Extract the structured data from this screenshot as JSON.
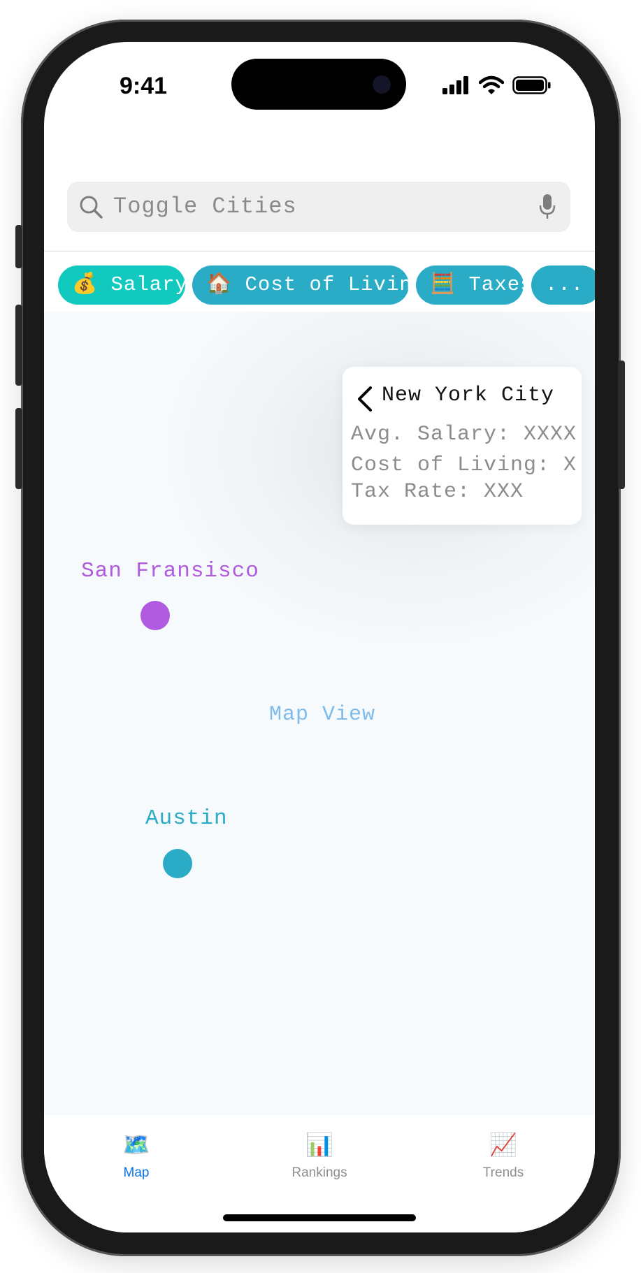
{
  "status_bar": {
    "time": "9:41"
  },
  "search": {
    "placeholder": "Toggle Cities"
  },
  "filters": [
    {
      "emoji": "💰",
      "label": "Salary",
      "active": true
    },
    {
      "emoji": "🏠",
      "label": "Cost of Living",
      "active": false
    },
    {
      "emoji": "🧮",
      "label": "Taxes",
      "active": false
    },
    {
      "emoji": "",
      "label": "...",
      "active": false
    }
  ],
  "map": {
    "label": "Map View",
    "cities": [
      {
        "name": "San Fransisco",
        "color": "#b05be0"
      },
      {
        "name": "Austin",
        "color": "#2aacc6"
      },
      {
        "name": "New York City",
        "color": "#0a72e8"
      }
    ]
  },
  "popup": {
    "title": "New York City",
    "avg_salary": "Avg. Salary: XXXX",
    "cost_of_living": "Cost of Living: X",
    "tax_rate": "Tax Rate: XXX"
  },
  "tabs": [
    {
      "icon": "🗺️",
      "label": "Map",
      "active": true
    },
    {
      "icon": "📊",
      "label": "Rankings",
      "active": false
    },
    {
      "icon": "📈",
      "label": "Trends",
      "active": false
    }
  ],
  "colors": {
    "accent": "#0a72e8",
    "chip": "#2aacc6",
    "chip_active": "#12c9c0",
    "inactive_tab": "#8e8e93"
  }
}
